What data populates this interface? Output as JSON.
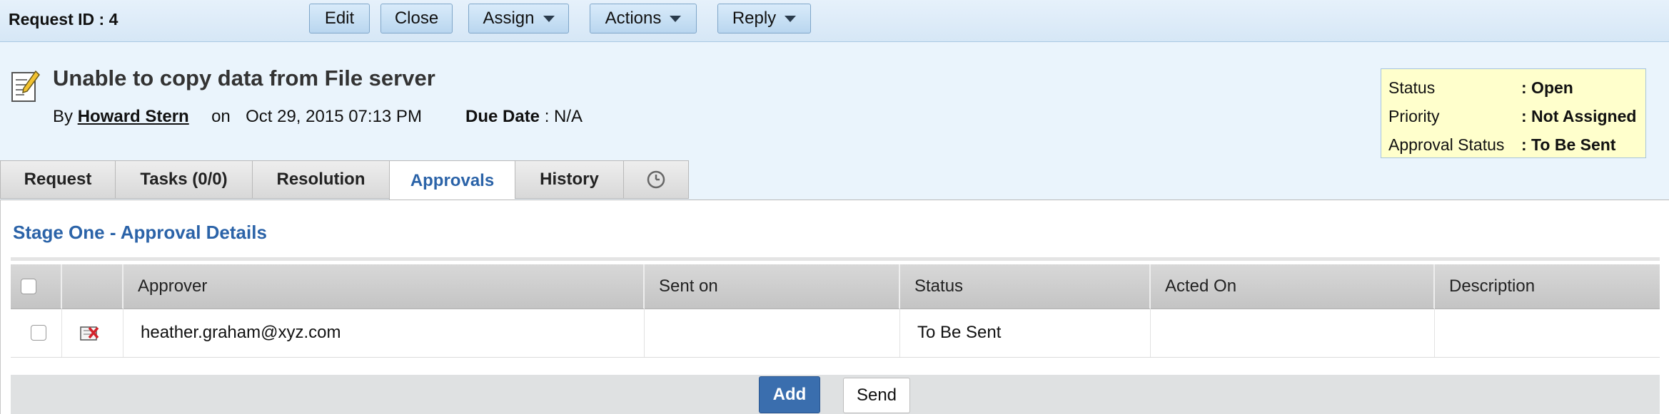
{
  "toolbar": {
    "request_id": "Request ID : 4",
    "buttons": [
      "Edit",
      "Close",
      "Assign",
      "Actions",
      "Reply"
    ]
  },
  "request": {
    "title": "Unable to copy data from File server",
    "by_label": "By",
    "author": "Howard Stern",
    "on_label": "on",
    "date": "Oct 29, 2015 07:13 PM",
    "due_label": "Due Date",
    "due_value": ": N/A"
  },
  "status_box": [
    {
      "label": "Status",
      "value": ": Open"
    },
    {
      "label": "Priority",
      "value": ": Not Assigned"
    },
    {
      "label": "Approval Status",
      "value": ": To Be Sent"
    }
  ],
  "tabs": [
    "Request",
    "Tasks (0/0)",
    "Resolution",
    "Approvals",
    "History"
  ],
  "active_tab": "Approvals",
  "approvals": {
    "stage_title": "Stage One - Approval Details",
    "columns": [
      "Approver",
      "Sent on",
      "Status",
      "Acted On",
      "Description"
    ],
    "rows": [
      {
        "approver": "heather.graham@xyz.com",
        "sent_on": "",
        "status": "To Be Sent",
        "acted_on": "",
        "description": ""
      }
    ],
    "add_label": "Add",
    "send_label": "Send"
  },
  "colors": {
    "accent": "#2b63a8",
    "add_button": "#3a6eae",
    "status_box": "#ffffcc"
  }
}
